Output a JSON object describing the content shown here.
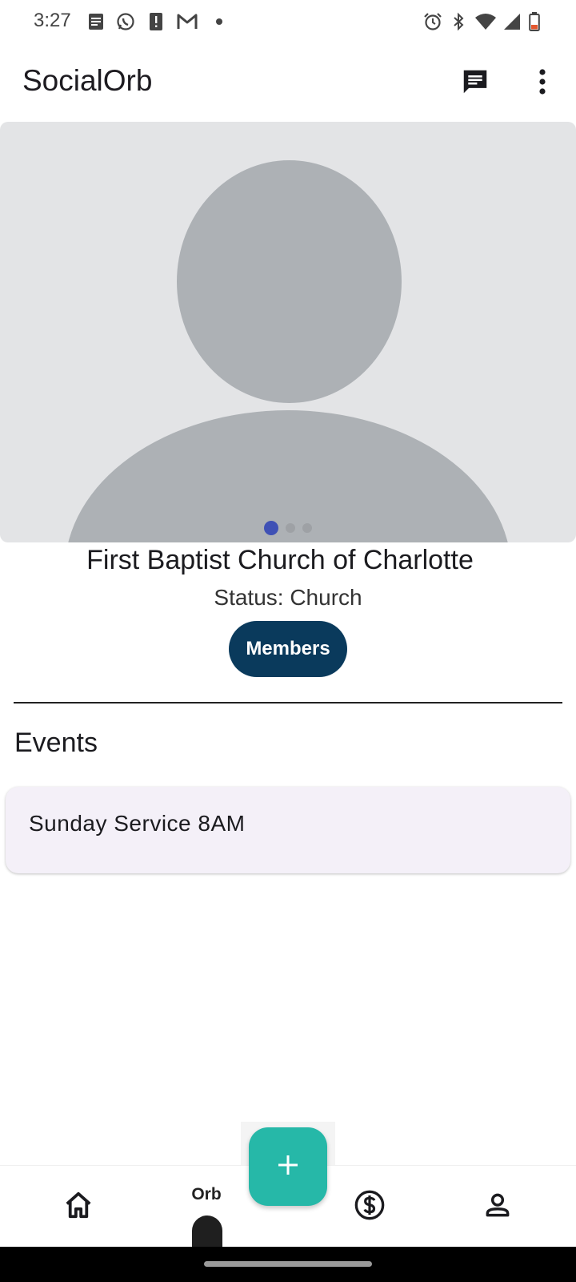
{
  "status_bar": {
    "time": "3:27",
    "left_icons": [
      "notes-icon",
      "whatsapp-icon",
      "alert-icon",
      "gmail-icon",
      "dot-icon"
    ],
    "right_icons": [
      "alarm-icon",
      "bluetooth-icon",
      "wifi-icon",
      "signal-icon",
      "battery-icon"
    ]
  },
  "app_bar": {
    "title": "SocialOrb",
    "actions": [
      "chat-icon",
      "more-vert-icon"
    ]
  },
  "carousel": {
    "page_count": 3,
    "active_index": 0,
    "active_color": "#3f51b5"
  },
  "profile": {
    "name": "First Baptist Church of Charlotte",
    "status": "Status: Church",
    "members_button": "Members"
  },
  "events": {
    "title": "Events",
    "items": [
      {
        "title": "Sunday Service 8AM"
      }
    ]
  },
  "bottom_nav": {
    "items": [
      {
        "name": "home",
        "icon": "home-icon",
        "label": ""
      },
      {
        "name": "orb",
        "icon": "orb-icon",
        "label": "Orb"
      },
      {
        "name": "money",
        "icon": "dollar-icon",
        "label": ""
      },
      {
        "name": "profile",
        "icon": "person-icon",
        "label": ""
      }
    ],
    "selected": "orb",
    "fab_icon": "plus-icon",
    "fab_color": "#26b8a8"
  }
}
